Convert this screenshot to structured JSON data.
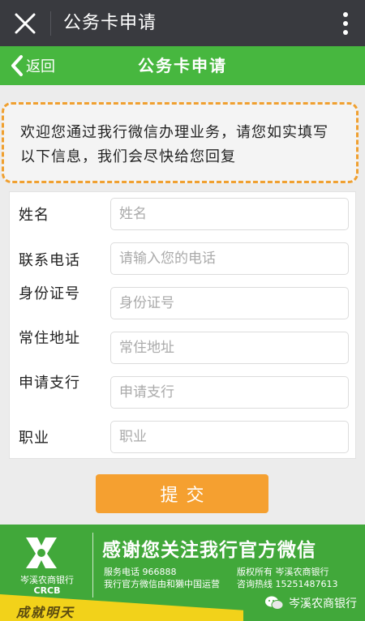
{
  "topbar": {
    "title": "公务卡申请"
  },
  "header": {
    "back_label": "返回",
    "title": "公务卡申请"
  },
  "notice": {
    "line1": "欢迎您通过我行微信办理业务，请您如实填写",
    "line2": "以下信息，我们会尽快给您回复"
  },
  "form": {
    "fields": [
      {
        "label": "姓名",
        "placeholder": "姓名"
      },
      {
        "label": "联系电话",
        "placeholder": "请输入您的电话"
      },
      {
        "label": "身份证号",
        "placeholder": "身份证号"
      },
      {
        "label": "常住地址",
        "placeholder": "常住地址"
      },
      {
        "label": "申请支行",
        "placeholder": "申请支行"
      },
      {
        "label": "职业",
        "placeholder": "职业"
      }
    ],
    "submit_label": "提交"
  },
  "banner": {
    "logo_cn": "岑溪农商银行",
    "logo_en": "CRCB",
    "slogan": "感谢您关注我行官方微信",
    "service_phone": "服务电话 966888",
    "operator": "我行官方微信由和獭中国运营",
    "copyright": "版权所有 岑溪农商银行",
    "hotline": "咨询热线 15251487613",
    "motto": "成就明天",
    "wechat_account": "岑溪农商银行"
  },
  "icons": {
    "close": "close-icon",
    "more": "more-vertical-icon",
    "back": "chevron-left-icon",
    "wechat": "wechat-icon",
    "logo": "bank-logo-icon"
  },
  "colors": {
    "topbar": "#393a3f",
    "header": "#47b73f",
    "accent": "#f5a030",
    "notice_border": "#f0a030"
  }
}
